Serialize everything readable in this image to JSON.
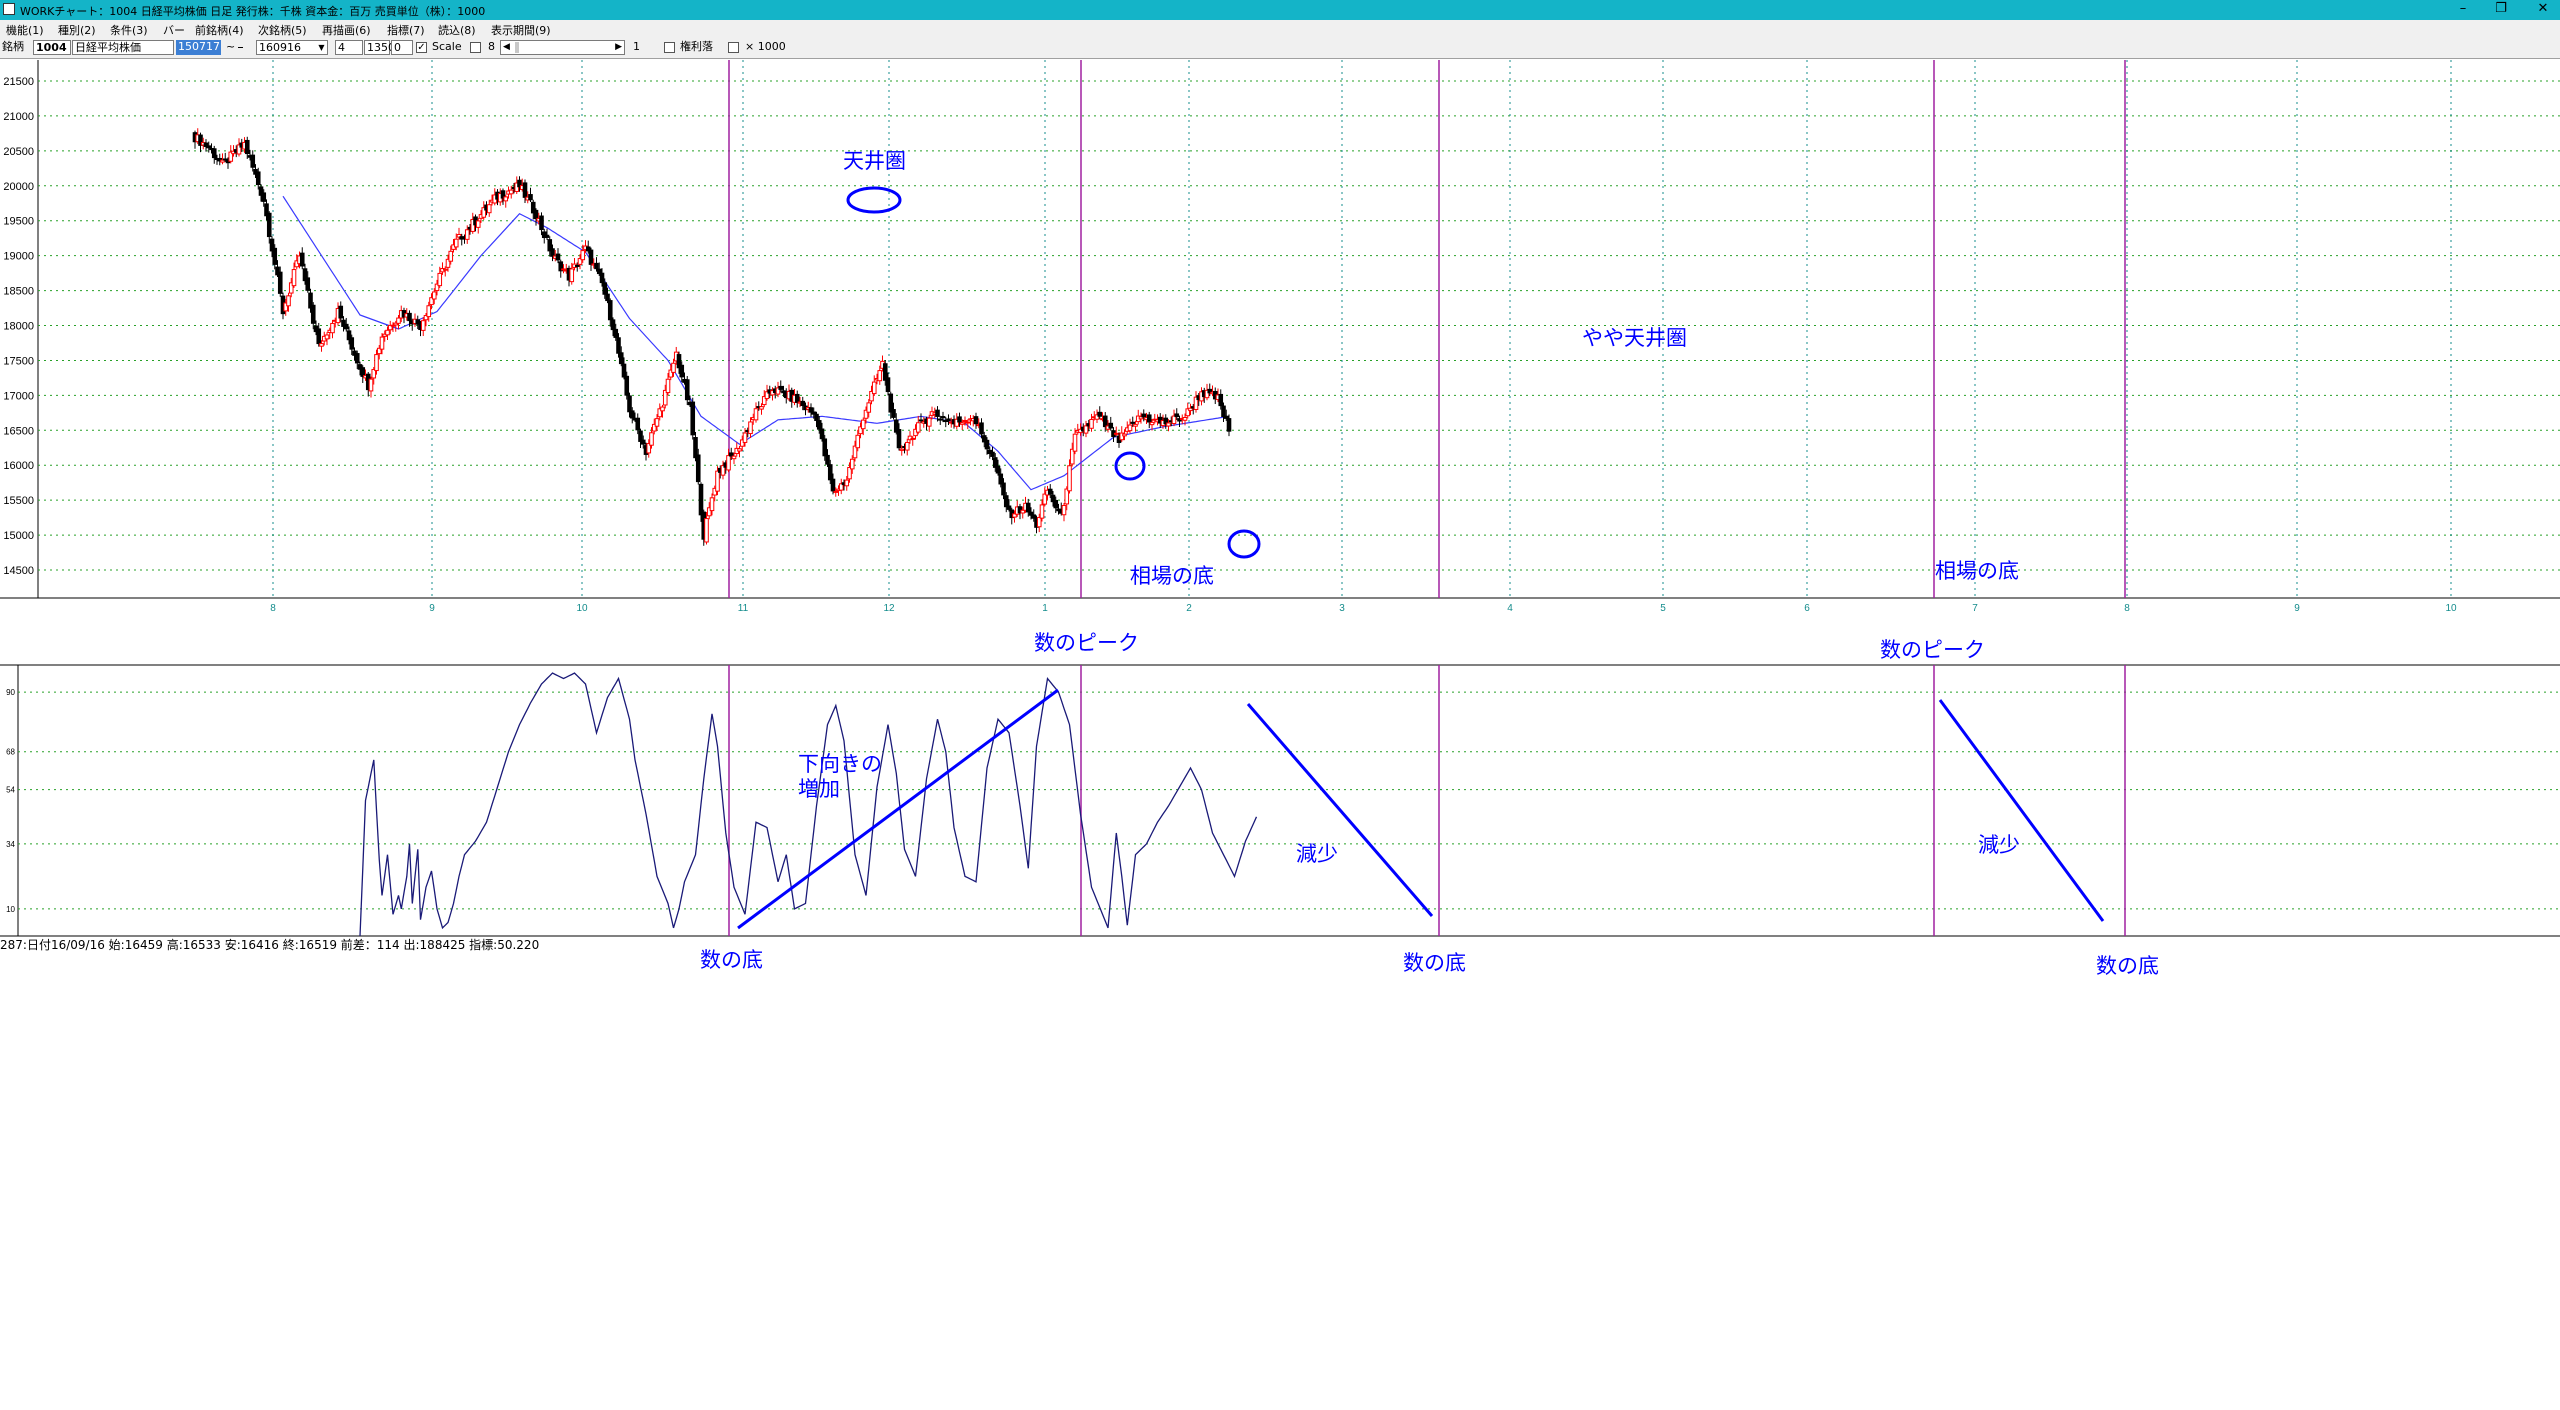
{
  "window": {
    "title": "WORKチャート：1004 日経平均株価  日足   発行株：千株  資本金：百万  売買単位（株）：1000",
    "minimize": "–",
    "restore": "❐",
    "close": "✕"
  },
  "menu": [
    "機能(1)",
    "種別(2)",
    "条件(3)",
    "バー",
    "前銘柄(4)",
    "次銘柄(5)",
    "再描画(6)",
    "指標(7)",
    "読込(8)",
    "表示期間(9)"
  ],
  "toolbar": {
    "code_label": "銘柄",
    "code": "1004",
    "name": "日経平均株価",
    "date_from": "150717",
    "date_sep": "~",
    "date_to": "160916",
    "field_a": "4",
    "field_b": "1350",
    "field_c": "0",
    "scale_label": "Scale",
    "scale_value": "8",
    "page_num": "1",
    "option1_label": "権利落",
    "option2_label": "× 1000"
  },
  "status_line": "287:日付16/09/16 始:16459 高:16533 安:16416 終:16519 前差：114 出:188425 指標:50.220",
  "annotations": {
    "ceiling": "天井圏",
    "slight_ceiling": "やや天井圏",
    "market_bottom_1": "相場の底",
    "market_bottom_2": "相場の底",
    "count_peak_1": "数のピーク",
    "count_peak_2": "数のピーク",
    "downward_increase_line1": "下向きの",
    "downward_increase_line2": "増加",
    "decrease_1": "減少",
    "decrease_2": "減少",
    "count_bottom_1": "数の底",
    "count_bottom_2": "数の底",
    "count_bottom_3": "数の底"
  },
  "colors": {
    "up_candle": "#ff0000",
    "down_candle": "#000000",
    "moving_average": "#3a3aff",
    "indicator_line": "#1a1a78",
    "annotation": "#0000ff",
    "period_divider": "#a020a0",
    "grid_horizontal": "#28a028",
    "grid_vertical": "#148c8c",
    "titlebar": "#14b4c8"
  },
  "chart_data": [
    {
      "type": "candlestick",
      "instrument": "日経平均株価",
      "y_ticks": [
        14500,
        15000,
        15500,
        16000,
        16500,
        17000,
        17500,
        18000,
        18500,
        19000,
        19500,
        20000,
        20500,
        21000,
        21500
      ],
      "x_tick_labels": [
        "8",
        "9",
        "10",
        "11",
        "12",
        "1",
        "2",
        "3",
        "4",
        "5",
        "6",
        "7",
        "8",
        "9",
        "10"
      ],
      "ylim": [
        14100,
        21800
      ],
      "close_waypoints": [
        [
          0,
          20700
        ],
        [
          5,
          20550
        ],
        [
          10,
          20300
        ],
        [
          18,
          20600
        ],
        [
          25,
          19800
        ],
        [
          32,
          18200
        ],
        [
          38,
          19000
        ],
        [
          45,
          17700
        ],
        [
          52,
          18200
        ],
        [
          58,
          17600
        ],
        [
          63,
          17150
        ],
        [
          68,
          17850
        ],
        [
          75,
          18200
        ],
        [
          82,
          18000
        ],
        [
          88,
          18600
        ],
        [
          95,
          19200
        ],
        [
          102,
          19500
        ],
        [
          110,
          19850
        ],
        [
          118,
          20000
        ],
        [
          124,
          19600
        ],
        [
          130,
          19000
        ],
        [
          136,
          18700
        ],
        [
          142,
          19100
        ],
        [
          148,
          18600
        ],
        [
          152,
          18000
        ],
        [
          158,
          16800
        ],
        [
          164,
          16200
        ],
        [
          170,
          16900
        ],
        [
          175,
          17600
        ],
        [
          180,
          16800
        ],
        [
          185,
          15000
        ],
        [
          190,
          15900
        ],
        [
          197,
          16200
        ],
        [
          203,
          16700
        ],
        [
          210,
          17100
        ],
        [
          218,
          16950
        ],
        [
          226,
          16700
        ],
        [
          232,
          15600
        ],
        [
          237,
          15800
        ],
        [
          243,
          16700
        ],
        [
          250,
          17450
        ],
        [
          256,
          16200
        ],
        [
          262,
          16500
        ],
        [
          268,
          16750
        ],
        [
          276,
          16600
        ],
        [
          283,
          16700
        ],
        [
          290,
          16100
        ],
        [
          296,
          15300
        ],
        [
          302,
          15400
        ],
        [
          306,
          15150
        ],
        [
          310,
          15650
        ],
        [
          315,
          15250
        ],
        [
          320,
          16400
        ],
        [
          328,
          16700
        ],
        [
          336,
          16350
        ],
        [
          344,
          16700
        ],
        [
          352,
          16600
        ],
        [
          360,
          16700
        ],
        [
          366,
          17050
        ],
        [
          372,
          16950
        ],
        [
          376,
          16500
        ]
      ],
      "moving_average_waypoints": [
        [
          32,
          19850
        ],
        [
          46,
          19000
        ],
        [
          60,
          18150
        ],
        [
          74,
          17950
        ],
        [
          88,
          18200
        ],
        [
          104,
          19000
        ],
        [
          118,
          19600
        ],
        [
          128,
          19400
        ],
        [
          142,
          19050
        ],
        [
          158,
          18100
        ],
        [
          172,
          17500
        ],
        [
          184,
          16700
        ],
        [
          198,
          16300
        ],
        [
          212,
          16650
        ],
        [
          228,
          16700
        ],
        [
          248,
          16600
        ],
        [
          264,
          16700
        ],
        [
          280,
          16600
        ],
        [
          292,
          16200
        ],
        [
          304,
          15650
        ],
        [
          316,
          15850
        ],
        [
          334,
          16400
        ],
        [
          352,
          16550
        ],
        [
          376,
          16700
        ]
      ]
    },
    {
      "type": "line",
      "y_ticks": [
        10,
        34,
        54,
        68,
        90
      ],
      "ylim": [
        0,
        100
      ],
      "start_index": 60,
      "waypoints": [
        [
          60,
          0
        ],
        [
          62,
          50
        ],
        [
          65,
          65
        ],
        [
          67,
          28
        ],
        [
          68,
          15
        ],
        [
          70,
          30
        ],
        [
          72,
          8
        ],
        [
          74,
          15
        ],
        [
          75,
          10
        ],
        [
          77,
          22
        ],
        [
          78,
          34
        ],
        [
          79,
          12
        ],
        [
          81,
          32
        ],
        [
          82,
          6
        ],
        [
          84,
          18
        ],
        [
          86,
          24
        ],
        [
          88,
          10
        ],
        [
          90,
          3
        ],
        [
          92,
          5
        ],
        [
          94,
          12
        ],
        [
          96,
          22
        ],
        [
          98,
          30
        ],
        [
          102,
          35
        ],
        [
          106,
          42
        ],
        [
          110,
          55
        ],
        [
          114,
          68
        ],
        [
          118,
          78
        ],
        [
          122,
          86
        ],
        [
          126,
          93
        ],
        [
          130,
          97
        ],
        [
          134,
          95
        ],
        [
          138,
          97
        ],
        [
          142,
          93
        ],
        [
          146,
          75
        ],
        [
          150,
          88
        ],
        [
          154,
          95
        ],
        [
          158,
          80
        ],
        [
          160,
          65
        ],
        [
          164,
          45
        ],
        [
          168,
          22
        ],
        [
          172,
          12
        ],
        [
          174,
          3
        ],
        [
          176,
          10
        ],
        [
          178,
          20
        ],
        [
          182,
          30
        ],
        [
          185,
          58
        ],
        [
          188,
          82
        ],
        [
          190,
          70
        ],
        [
          193,
          38
        ],
        [
          196,
          18
        ],
        [
          200,
          8
        ],
        [
          204,
          42
        ],
        [
          208,
          40
        ],
        [
          212,
          20
        ],
        [
          215,
          30
        ],
        [
          218,
          10
        ],
        [
          222,
          12
        ],
        [
          226,
          48
        ],
        [
          230,
          78
        ],
        [
          233,
          85
        ],
        [
          236,
          72
        ],
        [
          240,
          30
        ],
        [
          244,
          15
        ],
        [
          248,
          55
        ],
        [
          252,
          78
        ],
        [
          255,
          60
        ],
        [
          258,
          32
        ],
        [
          262,
          22
        ],
        [
          266,
          58
        ],
        [
          270,
          80
        ],
        [
          273,
          68
        ],
        [
          276,
          40
        ],
        [
          280,
          22
        ],
        [
          284,
          20
        ],
        [
          288,
          62
        ],
        [
          292,
          80
        ],
        [
          296,
          75
        ],
        [
          300,
          48
        ],
        [
          303,
          25
        ],
        [
          306,
          70
        ],
        [
          310,
          95
        ],
        [
          314,
          90
        ],
        [
          318,
          78
        ],
        [
          322,
          45
        ],
        [
          326,
          18
        ],
        [
          330,
          8
        ],
        [
          332,
          3
        ],
        [
          335,
          38
        ],
        [
          337,
          22
        ],
        [
          339,
          4
        ],
        [
          342,
          30
        ],
        [
          346,
          34
        ],
        [
          350,
          42
        ],
        [
          354,
          48
        ],
        [
          358,
          55
        ],
        [
          362,
          62
        ],
        [
          366,
          54
        ],
        [
          370,
          38
        ],
        [
          374,
          30
        ],
        [
          378,
          22
        ],
        [
          382,
          35
        ],
        [
          386,
          44
        ]
      ]
    }
  ]
}
